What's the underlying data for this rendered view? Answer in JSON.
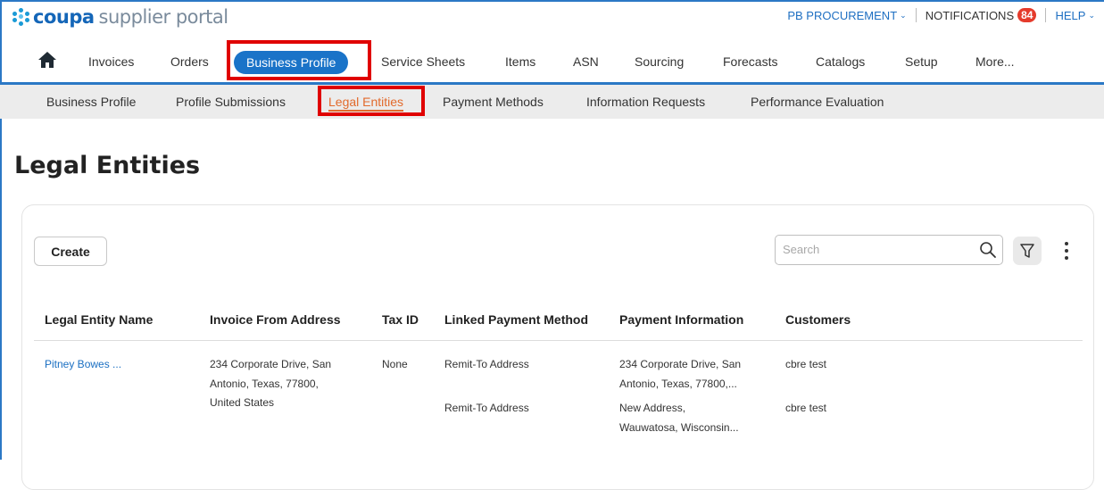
{
  "app": {
    "brand": "coupa",
    "brand_sub": "supplier portal"
  },
  "utility": {
    "account": "PB PROCUREMENT",
    "notifications_label": "NOTIFICATIONS",
    "notifications_count": "84",
    "help": "HELP"
  },
  "main_nav": {
    "items": [
      "Invoices",
      "Orders",
      "Business Profile",
      "Service Sheets",
      "Items",
      "ASN",
      "Sourcing",
      "Forecasts",
      "Catalogs",
      "Setup",
      "More..."
    ],
    "active": "Business Profile"
  },
  "sub_nav": {
    "items": [
      "Business Profile",
      "Profile Submissions",
      "Legal Entities",
      "Payment Methods",
      "Information Requests",
      "Performance Evaluation"
    ],
    "active": "Legal Entities"
  },
  "page": {
    "title": "Legal Entities"
  },
  "toolbar": {
    "create_label": "Create",
    "search_placeholder": "Search"
  },
  "table": {
    "columns": [
      "Legal Entity Name",
      "Invoice From Address",
      "Tax ID",
      "Linked Payment Method",
      "Payment Information",
      "Customers"
    ],
    "rows": [
      {
        "legal_entity_name": "Pitney Bowes ...",
        "invoice_from_address": [
          "234 Corporate Drive, San",
          "Antonio, Texas, 77800,",
          "United States"
        ],
        "tax_id": "None",
        "payments": [
          {
            "method": "Remit-To Address",
            "info": [
              "234 Corporate Drive, San",
              "Antonio, Texas, 77800,..."
            ],
            "customer": "cbre test"
          },
          {
            "method": "Remit-To Address",
            "info": [
              "New Address,",
              "Wauwatosa, Wisconsin..."
            ],
            "customer": "cbre test"
          }
        ]
      }
    ]
  },
  "colors": {
    "brand_blue": "#1a73c8",
    "highlight_red": "#e00000",
    "active_tab_orange": "#e26a2c",
    "badge_red": "#e53b2c"
  }
}
